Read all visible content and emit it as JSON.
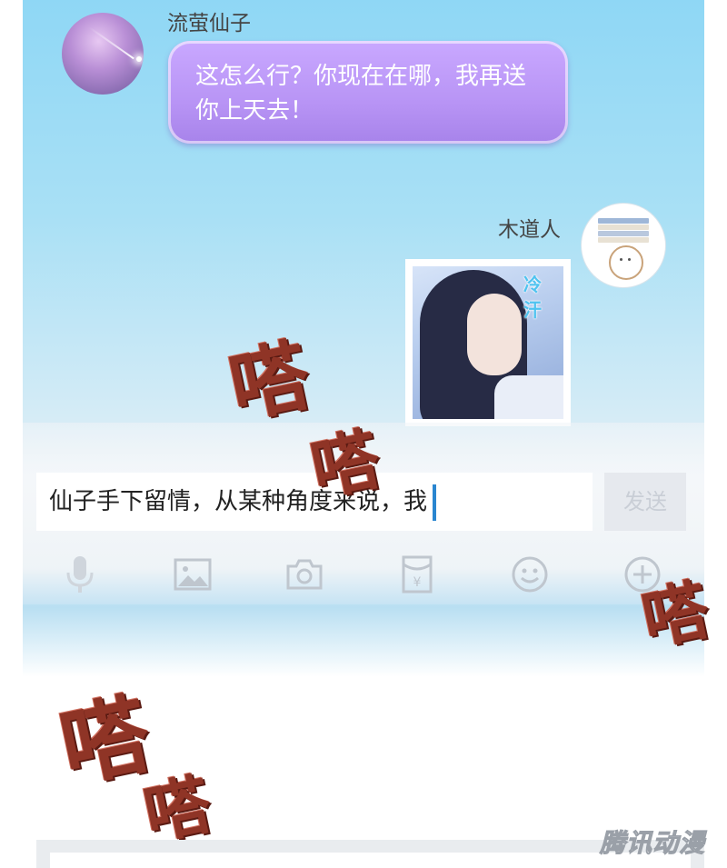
{
  "chat": {
    "messages": [
      {
        "sender": "流萤仙子",
        "text": "这怎么行？你现在在哪，我再送你上天去！"
      },
      {
        "sender": "木道人",
        "sticker_caption": "冷汗"
      }
    ]
  },
  "composer": {
    "input_value": "仙子手下留情，从某种角度来说，我",
    "send_label": "发送",
    "toolbar_icons": [
      "microphone-icon",
      "image-icon",
      "camera-icon",
      "red-envelope-icon",
      "emoji-icon",
      "plus-icon"
    ]
  },
  "sound_effects": [
    "嗒",
    "嗒",
    "嗒",
    "嗒",
    "嗒"
  ],
  "watermark": "腾讯动漫",
  "colors": {
    "bubble": "#b894f5",
    "caret": "#2a86d0",
    "sfx": "#8f3426"
  }
}
